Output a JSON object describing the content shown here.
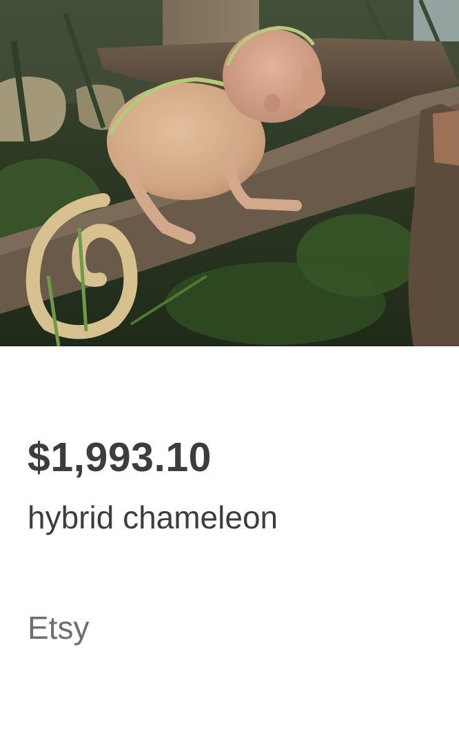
{
  "product": {
    "price": "$1,993.10",
    "title": "hybrid chameleon",
    "seller": "Etsy",
    "image": "photo of a chameleon-like creature with a human face on a tree branch"
  },
  "colors": {
    "text_primary": "#3d3d41",
    "text_secondary": "#6e6e72",
    "background": "#ffffff"
  }
}
